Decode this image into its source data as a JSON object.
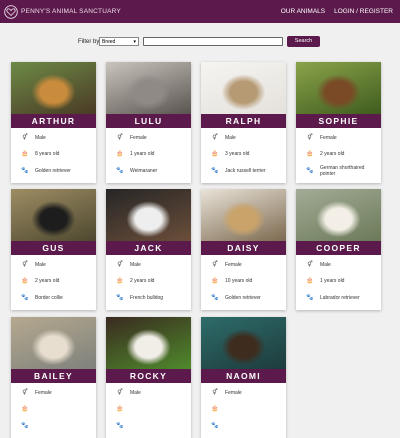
{
  "header": {
    "brand": "PENNY'S ANIMAL SANCTUARY",
    "nav": [
      "OUR ANIMALS",
      "LOGIN / REGISTER"
    ]
  },
  "filter": {
    "label": "Filter by",
    "selected": "Breed",
    "button": "Search"
  },
  "icons": {
    "sex": "gender-icon",
    "age": "cake-icon",
    "breed": "paw-icon"
  },
  "colors": {
    "brand": "#5b1a4b"
  },
  "animals": [
    {
      "name": "ARTHUR",
      "sex": "Male",
      "age": "8 years old",
      "breed": "Golden retriever",
      "photo": [
        "#4a3a25",
        "#c98b3c",
        "#6d8a46"
      ]
    },
    {
      "name": "LULU",
      "sex": "Female",
      "age": "1 years old",
      "breed": "Weimaraner",
      "photo": [
        "#5a5550",
        "#8f8a85",
        "#c9c4bd"
      ]
    },
    {
      "name": "RALPH",
      "sex": "Male",
      "age": "3 years old",
      "breed": "Jack russell terrier",
      "photo": [
        "#e4e1dc",
        "#b59a74",
        "#f6f4f1"
      ]
    },
    {
      "name": "SOPHIE",
      "sex": "Female",
      "age": "2 years old",
      "breed": "German shorthaired pointer",
      "photo": [
        "#3f5c1e",
        "#7a4a26",
        "#8aa34a"
      ]
    },
    {
      "name": "GUS",
      "sex": "Male",
      "age": "2 years old",
      "breed": "Border collie",
      "photo": [
        "#4e4830",
        "#1d1d1d",
        "#9d8d63"
      ]
    },
    {
      "name": "JACK",
      "sex": "Male",
      "age": "2 years old",
      "breed": "French bulldog",
      "photo": [
        "#6b4e3a",
        "#eeeeee",
        "#262626"
      ]
    },
    {
      "name": "DAISY",
      "sex": "Female",
      "age": "10 years old",
      "breed": "Golden retriever",
      "photo": [
        "#7d6a50",
        "#c9a36a",
        "#e9e3d8"
      ]
    },
    {
      "name": "COOPER",
      "sex": "Male",
      "age": "1 years old",
      "breed": "Labrador retriever",
      "photo": [
        "#6c7a58",
        "#f3efe6",
        "#a2ab96"
      ]
    },
    {
      "name": "BAILEY",
      "sex": "Female",
      "age": "",
      "breed": "",
      "photo": [
        "#7f817c",
        "#e7ded0",
        "#b5a98f"
      ]
    },
    {
      "name": "ROCKY",
      "sex": "Male",
      "age": "",
      "breed": "",
      "photo": [
        "#4f8a2c",
        "#f1ede7",
        "#3a2a20"
      ]
    },
    {
      "name": "NAOMI",
      "sex": "Female",
      "age": "",
      "breed": "",
      "photo": [
        "#1e3b3c",
        "#3e2c1f",
        "#2d6c6a"
      ]
    }
  ]
}
